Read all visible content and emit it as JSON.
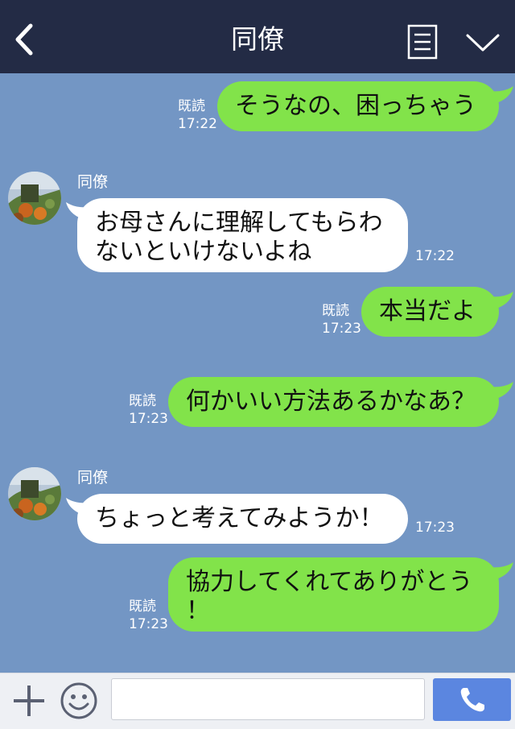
{
  "header": {
    "title": "同僚",
    "back_icon": "chevron-left-icon",
    "menu_icon": "notes-icon",
    "collapse_icon": "chevron-down-icon",
    "background": "#232b45"
  },
  "chat": {
    "background": "#7396c4",
    "outgoing_color": "#82e34a",
    "incoming_color": "#ffffff",
    "messages": [
      {
        "direction": "out",
        "lines": [
          "そうなの、困っちゃう"
        ],
        "read": "既読",
        "time": "17:22"
      },
      {
        "direction": "in",
        "sender": "同僚",
        "lines": [
          "お母さんに理解してもらわ",
          "ないといけないよね"
        ],
        "time": "17:22"
      },
      {
        "direction": "out",
        "lines": [
          "本当だよ"
        ],
        "read": "既読",
        "time": "17:23"
      },
      {
        "direction": "out",
        "lines": [
          "何かいい方法あるかなあ？"
        ],
        "read": "既読",
        "time": "17:23"
      },
      {
        "direction": "in",
        "sender": "同僚",
        "lines": [
          "ちょっと考えてみようか！"
        ],
        "time": "17:23"
      },
      {
        "direction": "out",
        "lines": [
          "協力してくれてありがとう",
          "！"
        ],
        "read": "既読",
        "time": "17:23"
      }
    ]
  },
  "footer": {
    "plus_icon": "plus-icon",
    "emoji_icon": "smiley-icon",
    "input_value": "",
    "input_placeholder": "",
    "call_icon": "phone-icon",
    "call_color": "#5b86e0"
  }
}
